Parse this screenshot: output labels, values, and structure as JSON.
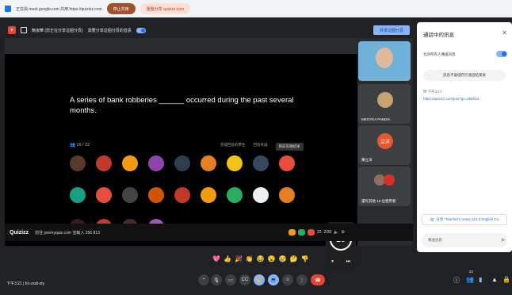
{
  "share_bar": {
    "text": "正在與 meet.google.com 共用 https://quizizz.com",
    "stop_label": "停止共用",
    "switch_label": "重整分享 quizizz.com"
  },
  "stage_bar": {
    "presenter": "簡淑華 (您正在分享這個分頁)",
    "audio_label": "需要分享這個分頁的音訊",
    "share_this_tab": "共享這個分頁"
  },
  "quiz": {
    "question": "A series of bank robberies ______ occurred during the past several months.",
    "counter": "16 / 22",
    "tabs": [
      "完成回答的學生",
      "回答有誤",
      "目前答題結果"
    ],
    "timer": "19",
    "footer_url": "前往 joinmyquiz.com 並輸入 256 813",
    "score": "22",
    "progress": "2/30"
  },
  "tiles": [
    {
      "name": "MEGYKA PANDIA"
    },
    {
      "name": "陳立洋",
      "initials": "立洋"
    },
    {
      "name": "還有其他 18 位使用者"
    }
  ],
  "chat": {
    "title": "通話中的訊息",
    "allow_label": "允許所有人傳送訊息",
    "note": "訊息不會儲存於通話結束後",
    "author": "你 下午3:17",
    "link": "https://quizizz.com/join?gc=256813",
    "pinned": "分享 \"Teacher's notes-112-2 English Co...",
    "input_placeholder": "傳送訊息"
  },
  "bottom": {
    "time_meet": "下午3:21 | frc-zxdi-xty",
    "reactions": [
      "💖",
      "👍",
      "🎉",
      "👏",
      "😂",
      "😮",
      "😢",
      "🤔",
      "👎"
    ],
    "participants_count": "22"
  },
  "colors": {
    "accent": "#8ab4f8",
    "end_call": "#ea4335",
    "stop_chip": "#a0522d"
  }
}
